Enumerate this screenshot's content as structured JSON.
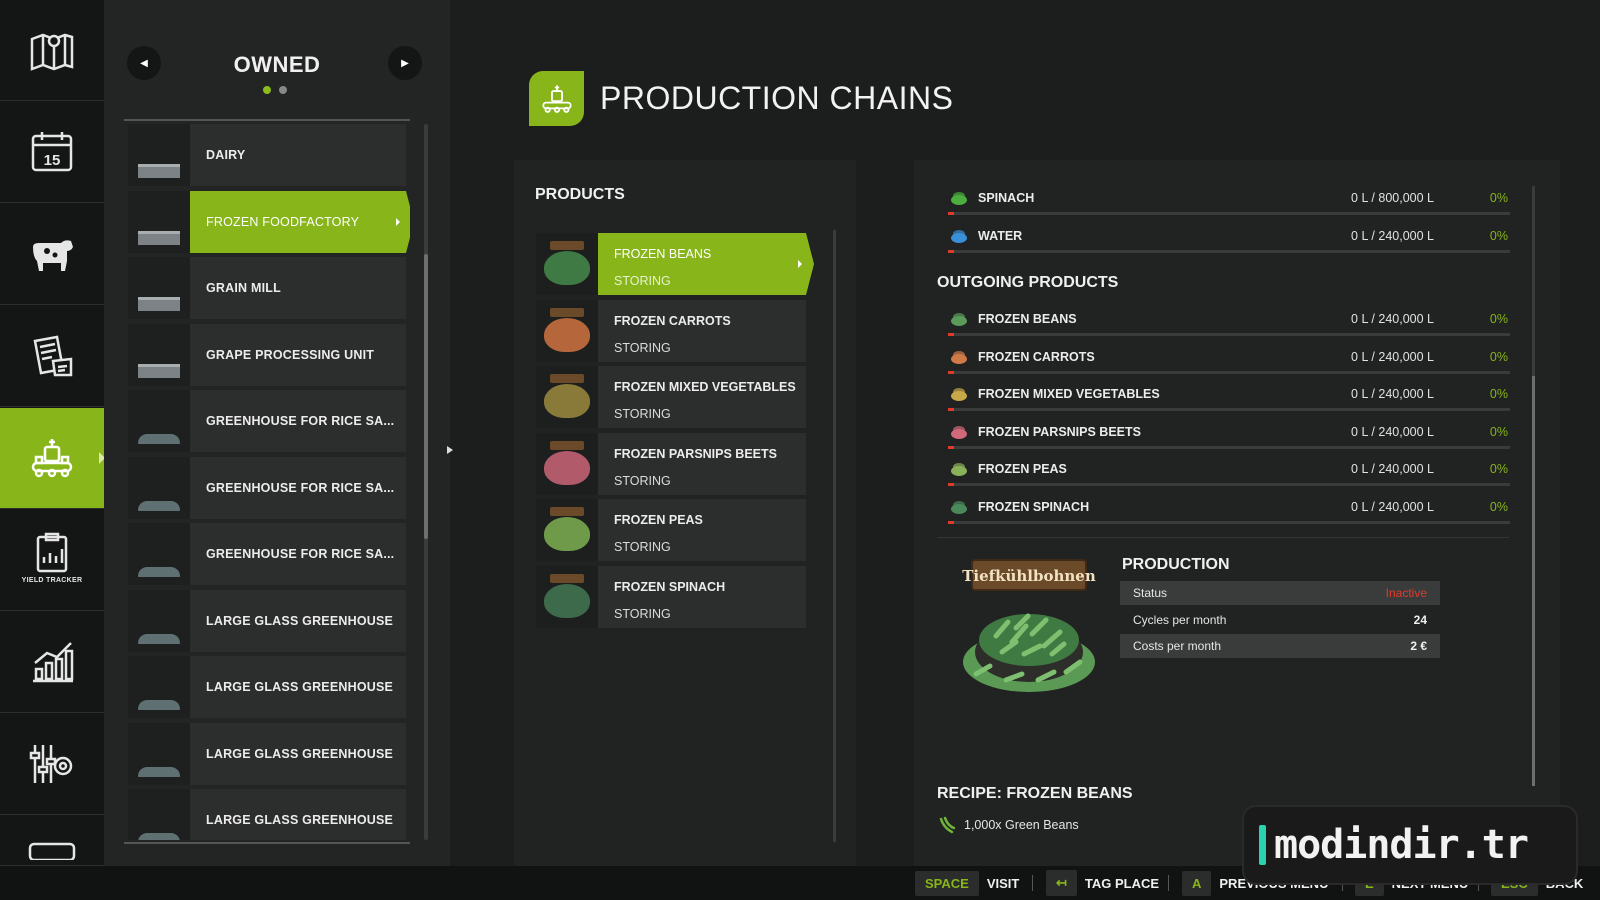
{
  "rail": {
    "items": [
      {
        "icon": "map-icon"
      },
      {
        "icon": "calendar-icon",
        "day": "15"
      },
      {
        "icon": "animals-icon"
      },
      {
        "icon": "contracts-icon"
      },
      {
        "icon": "production-icon",
        "active": true
      },
      {
        "icon": "yield-tracker-icon",
        "label": "YIELD TRACKER"
      },
      {
        "icon": "statistics-icon"
      },
      {
        "icon": "settings-icon"
      },
      {
        "icon": "help-icon"
      }
    ]
  },
  "owned": {
    "title": "OWNED",
    "page_dots": 2,
    "active_dot": 1,
    "items": [
      {
        "label": "DAIRY"
      },
      {
        "label": "FROZEN FOODFACTORY",
        "active": true
      },
      {
        "label": "GRAIN MILL"
      },
      {
        "label": "GRAPE PROCESSING UNIT"
      },
      {
        "label": "GREENHOUSE FOR RICE SA..."
      },
      {
        "label": "GREENHOUSE FOR RICE SA..."
      },
      {
        "label": "GREENHOUSE FOR RICE SA..."
      },
      {
        "label": "LARGE GLASS GREENHOUSE"
      },
      {
        "label": "LARGE GLASS GREENHOUSE"
      },
      {
        "label": "LARGE GLASS GREENHOUSE"
      },
      {
        "label": "LARGE GLASS GREENHOUSE"
      }
    ]
  },
  "page": {
    "title": "PRODUCTION CHAINS",
    "accent": "#87b51a"
  },
  "products": {
    "title": "PRODUCTS",
    "items": [
      {
        "name": "FROZEN BEANS",
        "status": "STORING",
        "active": true,
        "color": "#3f7a45"
      },
      {
        "name": "FROZEN CARROTS",
        "status": "STORING",
        "color": "#b5663a"
      },
      {
        "name": "FROZEN MIXED VEGETABLES",
        "status": "STORING",
        "color": "#8a7a3a"
      },
      {
        "name": "FROZEN PARSNIPS BEETS",
        "status": "STORING",
        "color": "#b05a6a"
      },
      {
        "name": "FROZEN PEAS",
        "status": "STORING",
        "color": "#6f9a4a"
      },
      {
        "name": "FROZEN SPINACH",
        "status": "STORING",
        "color": "#3d6a4a"
      }
    ]
  },
  "incoming": [
    {
      "name": "SPINACH",
      "amount": "0 L / 800,000 L",
      "percent": "0%",
      "fill": 0.005,
      "icon_color": "#4cae3c"
    },
    {
      "name": "WATER",
      "amount": "0 L / 240,000 L",
      "percent": "0%",
      "fill": 0.005,
      "icon_color": "#3a8fd9"
    }
  ],
  "outgoing": {
    "title": "OUTGOING PRODUCTS",
    "items": [
      {
        "name": "FROZEN BEANS",
        "amount": "0 L / 240,000 L",
        "percent": "0%",
        "fill": 0.005,
        "icon_color": "#5a9a5a"
      },
      {
        "name": "FROZEN CARROTS",
        "amount": "0 L / 240,000 L",
        "percent": "0%",
        "fill": 0.005,
        "icon_color": "#d07a48"
      },
      {
        "name": "FROZEN MIXED VEGETABLES",
        "amount": "0 L / 240,000 L",
        "percent": "0%",
        "fill": 0.005,
        "icon_color": "#c9a84a"
      },
      {
        "name": "FROZEN PARSNIPS BEETS",
        "amount": "0 L / 240,000 L",
        "percent": "0%",
        "fill": 0.005,
        "icon_color": "#d06a7a"
      },
      {
        "name": "FROZEN PEAS",
        "amount": "0 L / 240,000 L",
        "percent": "0%",
        "fill": 0.005,
        "icon_color": "#8ab05a"
      },
      {
        "name": "FROZEN SPINACH",
        "amount": "0 L / 240,000 L",
        "percent": "0%",
        "fill": 0.005,
        "icon_color": "#4a8a5a"
      }
    ]
  },
  "production": {
    "title": "PRODUCTION",
    "image_label": "Tiefkühlbohnen",
    "rows": [
      {
        "key": "Status",
        "value": "Inactive",
        "bad": true
      },
      {
        "key": "Cycles per month",
        "value": "24"
      },
      {
        "key": "Costs per month",
        "value": "2 €"
      }
    ]
  },
  "recipe": {
    "title": "RECIPE: FROZEN BEANS",
    "ingredients": [
      {
        "text": "1,000x Green Beans"
      }
    ]
  },
  "bottom_bar": {
    "hints": [
      {
        "key": "SPACE",
        "label": "VISIT"
      },
      {
        "key": "↤",
        "label": "TAG PLACE"
      },
      {
        "key": "A",
        "label": "PREVIOUS MENU"
      },
      {
        "key": "E",
        "label": "NEXT MENU"
      },
      {
        "key": "ESC",
        "label": "BACK"
      }
    ]
  },
  "watermark": {
    "text": "modindir.tr",
    "accent": "#2ad3b0"
  }
}
